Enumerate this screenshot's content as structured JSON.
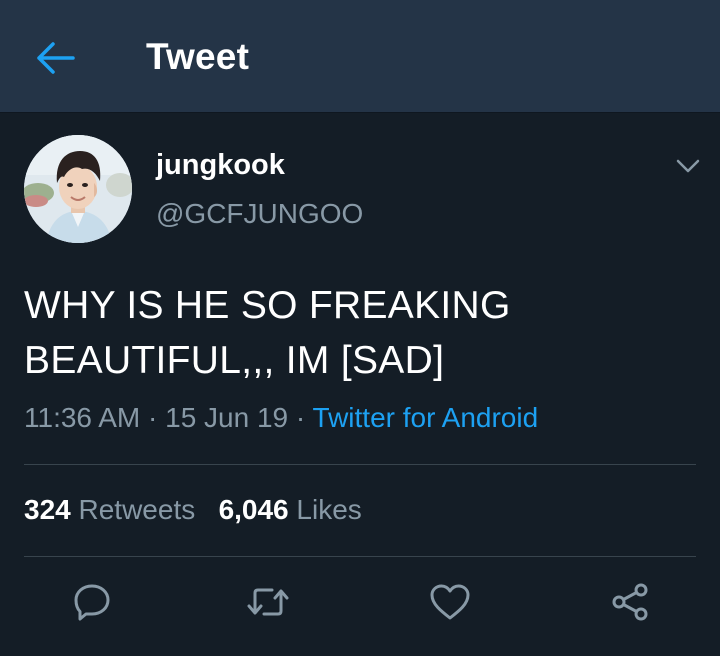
{
  "header": {
    "title": "Tweet",
    "back_icon": "back-arrow-icon"
  },
  "tweet": {
    "display_name": "jungkook",
    "handle": "@GCFJUNGOO",
    "text_lines": [
      "WHY IS HE SO FREAKING",
      "BEAUTIFUL,,, IM [SAD]"
    ],
    "time": "11:36 AM",
    "date": "15 Jun 19",
    "separator": " · ",
    "source": "Twitter for Android",
    "retweets_count": "324",
    "retweets_label": "Retweets",
    "likes_count": "6,046",
    "likes_label": "Likes"
  },
  "actions": [
    "reply-icon",
    "retweet-icon",
    "like-icon",
    "share-icon"
  ],
  "colors": {
    "header_bg": "#243447",
    "background": "#141d26",
    "accent": "#1da1f2",
    "secondary_text": "#8899a6",
    "divider": "#38444d"
  }
}
